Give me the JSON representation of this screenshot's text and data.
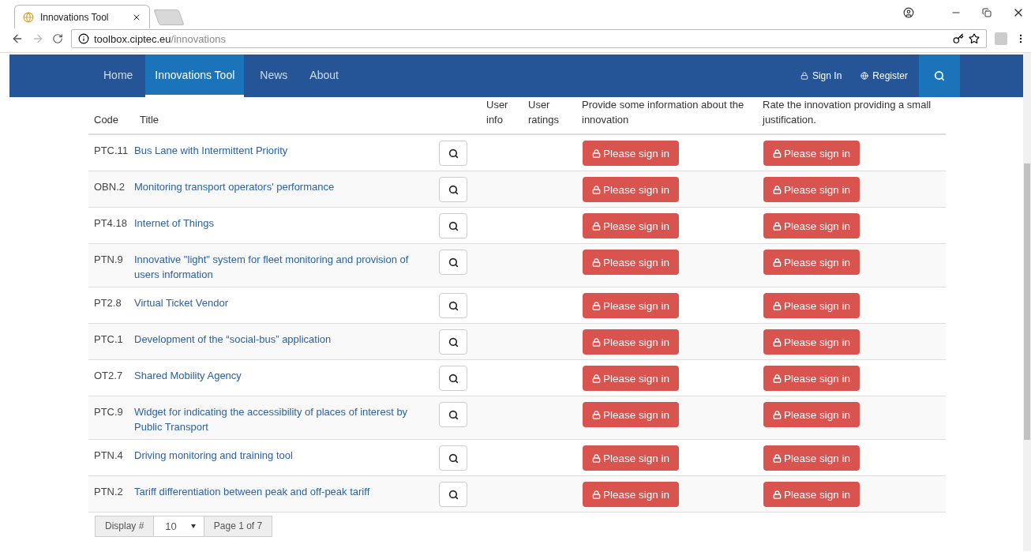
{
  "browser": {
    "tab_title": "Innovations Tool",
    "url_host": "toolbox.ciptec.eu",
    "url_path": "/innovations"
  },
  "nav": {
    "items": [
      {
        "label": "Home",
        "selected": false
      },
      {
        "label": "Innovations Tool",
        "selected": true
      },
      {
        "label": "News",
        "selected": false
      },
      {
        "label": "About",
        "selected": false
      }
    ],
    "sign_in": "Sign In",
    "register": "Register"
  },
  "table": {
    "columns": [
      "Code",
      "Title",
      "",
      "User info",
      "User ratings",
      "Provide some information about the innovation",
      "Rate the innovation providing a small justification."
    ],
    "rows": [
      {
        "code": "PTC.11",
        "title": "Bus Lane with Intermittent Priority",
        "info_action": "Please sign in",
        "rate_action": "Please sign in"
      },
      {
        "code": "OBN.2",
        "title": "Monitoring transport operators' performance",
        "info_action": "Please sign in",
        "rate_action": "Please sign in"
      },
      {
        "code": "PT4.18",
        "title": "Internet of Things",
        "info_action": "Please sign in",
        "rate_action": "Please sign in"
      },
      {
        "code": "PTN.9",
        "title": "Innovative \"light\" system for fleet monitoring and provision of users information",
        "info_action": "Please sign in",
        "rate_action": "Please sign in"
      },
      {
        "code": "PT2.8",
        "title": "Virtual Ticket Vendor",
        "info_action": "Please sign in",
        "rate_action": "Please sign in"
      },
      {
        "code": "PTC.1",
        "title": "Development of the “social-bus” application",
        "info_action": "Please sign in",
        "rate_action": "Please sign in"
      },
      {
        "code": "OT2.7",
        "title": "Shared Mobility Agency",
        "info_action": "Please sign in",
        "rate_action": "Please sign in"
      },
      {
        "code": "PTC.9",
        "title": "Widget for indicating the accessibility of places of interest by Public Transport",
        "info_action": "Please sign in",
        "rate_action": "Please sign in"
      },
      {
        "code": "PTN.4",
        "title": "Driving monitoring and training tool",
        "info_action": "Please sign in",
        "rate_action": "Please sign in"
      },
      {
        "code": "PTN.2",
        "title": "Tariff differentiation between peak and off-peak tariff",
        "info_action": "Please sign in",
        "rate_action": "Please sign in"
      }
    ]
  },
  "pagination": {
    "display_label": "Display #",
    "page_size": "10",
    "page_info": "Page 1 of 7"
  }
}
